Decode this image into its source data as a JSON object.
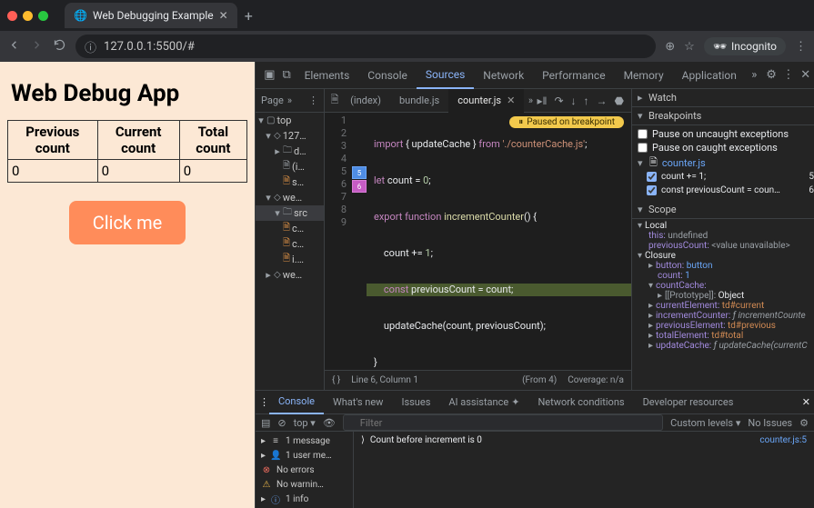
{
  "browser": {
    "tab_title": "Web Debugging Example",
    "url": "127.0.0.1:5500/#",
    "incognito": "Incognito"
  },
  "page": {
    "heading": "Web Debug App",
    "th1": "Previous count",
    "th2": "Current count",
    "th3": "Total count",
    "v1": "0",
    "v2": "0",
    "v3": "0",
    "button": "Click me"
  },
  "devtools": {
    "tabs": [
      "Elements",
      "Console",
      "Sources",
      "Network",
      "Performance",
      "Memory",
      "Application"
    ],
    "nav_header": "Page",
    "tree": {
      "top": "top",
      "host": "127…",
      "d": "d…",
      "i": "(i…",
      "s": "s…",
      "we1": "we…",
      "src": "src",
      "c": "c…",
      "c2": "c…",
      "ijs": "i.…",
      "we2": "we…"
    },
    "editor": {
      "tabs": [
        "(index)",
        "bundle.js",
        "counter.js"
      ],
      "paused": "Paused on breakpoint",
      "code": {
        "l1_a": "import",
        "l1_b": " { updateCache } ",
        "l1_c": "from",
        "l1_d": " './counterCache.js'",
        "l2": "let",
        "l2b": " count = ",
        "l2c": "0",
        "l2d": ";",
        "l3": "export function",
        "l3b": " incrementCounter",
        "l3c": "() {",
        "l4": "    count += ",
        "l4b": "1",
        "l4c": ";",
        "l5": "    const",
        "l5b": " previousCount = count;",
        "l6": "    updateCache(count, previousCount);",
        "l7": "}",
        "bp5": "5",
        "bp6": "6"
      },
      "status_left": "Line 6, Column 1",
      "status_mid": "(From 4)",
      "status_right": "Coverage: n/a"
    },
    "right": {
      "watch": "Watch",
      "breakpoints": "Breakpoints",
      "pause_un": "Pause on uncaught exceptions",
      "pause_ca": "Pause on caught exceptions",
      "bp_file": "counter.js",
      "bp1": "count += 1;",
      "bp1l": "5",
      "bp2": "const previousCount = coun…",
      "bp2l": "6",
      "scope": "Scope",
      "local": "Local",
      "this": "this: ",
      "this_v": "undefined",
      "prev": "previousCount: ",
      "prev_v": "<value unavailable>",
      "closure": "Closure",
      "button": "button: ",
      "button_v": "button",
      "count": "count: ",
      "count_v": "1",
      "cc": "countCache:",
      "proto": "[[Prototype]]: ",
      "proto_v": "Object",
      "cur": "currentElement: ",
      "cur_v": "td#current",
      "inc": "incrementCounter: ",
      "inc_v": "ƒ incrementCounte",
      "preve": "previousElement: ",
      "preve_v": "td#previous",
      "tot": "totalElement: ",
      "tot_v": "td#total",
      "upd": "updateCache: ",
      "upd_v": "ƒ updateCache(currentC"
    },
    "drawer": {
      "tabs": [
        "Console",
        "What's new",
        "Issues",
        "AI assistance",
        "Network conditions",
        "Developer resources"
      ],
      "top": "top",
      "filter_ph": "Filter",
      "levels": "Custom levels",
      "noissues": "No Issues",
      "summary": {
        "msg": "1 message",
        "usr": "1 user me…",
        "err": "No errors",
        "wrn": "No warnin…",
        "inf": "1 info"
      },
      "log": "Count before increment is 0",
      "log_src": "counter.js:5"
    }
  }
}
